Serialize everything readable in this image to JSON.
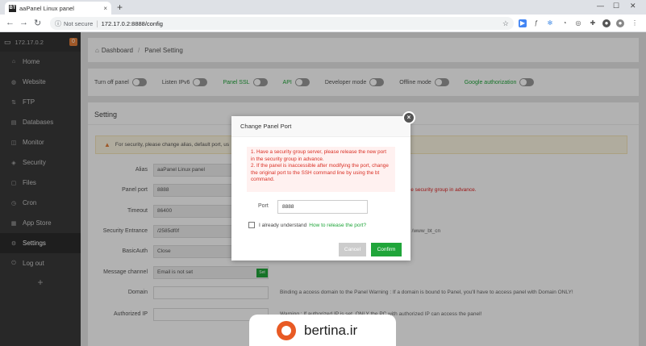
{
  "browser": {
    "tab_favicon": "BT",
    "tab_title": "aaPanel Linux panel",
    "tab_close": "×",
    "new_tab": "+",
    "win_controls": [
      "—",
      "☐",
      "✕"
    ],
    "nav_icons": [
      "←",
      "→",
      "↻"
    ],
    "not_secure": "Not secure",
    "url": "172.17.0.2:8888/config",
    "extensions": [
      "star-icon",
      "ext-icon-1",
      "ext-icon-2",
      "ext-icon-3",
      "puzzle-icon",
      "profile-icon",
      "menu-icon"
    ]
  },
  "sidebar": {
    "ip": "172.17.0.2",
    "badge": "0",
    "items": [
      {
        "label": "Home",
        "icon": "home-icon",
        "active": false
      },
      {
        "label": "Website",
        "icon": "globe-icon",
        "active": false
      },
      {
        "label": "FTP",
        "icon": "ftp-icon",
        "active": false
      },
      {
        "label": "Databases",
        "icon": "database-icon",
        "active": false
      },
      {
        "label": "Monitor",
        "icon": "monitor-icon",
        "active": false
      },
      {
        "label": "Security",
        "icon": "shield-icon",
        "active": false
      },
      {
        "label": "Files",
        "icon": "folder-icon",
        "active": false
      },
      {
        "label": "Cron",
        "icon": "clock-icon",
        "active": false
      },
      {
        "label": "App Store",
        "icon": "store-icon",
        "active": false
      },
      {
        "label": "Settings",
        "icon": "settings-icon",
        "active": true
      },
      {
        "label": "Log out",
        "icon": "logout-icon",
        "active": false
      }
    ],
    "plus": "+"
  },
  "breadcrumb": {
    "home": "Dashboard",
    "current": "Panel Setting"
  },
  "toggles": [
    {
      "label": "Turn off panel",
      "green": false
    },
    {
      "label": "Listen IPv6",
      "green": false
    },
    {
      "label": "Panel SSL",
      "green": true
    },
    {
      "label": "API",
      "green": true
    },
    {
      "label": "Developer mode",
      "green": false
    },
    {
      "label": "Offline mode",
      "green": false
    },
    {
      "label": "Google authorization",
      "green": true
    }
  ],
  "settings": {
    "heading": "Setting",
    "warning": "For security, please change alias, default port, us",
    "rows": [
      {
        "label": "Alias",
        "value": "aaPanel Linux panel",
        "note": "",
        "red": false,
        "btn": ""
      },
      {
        "label": "Panel port",
        "value": "8888",
        "note": "rs with security groups, please release the new port in the security group in advance.",
        "red": true,
        "btn": ""
      },
      {
        "label": "Timeout",
        "value": "86400",
        "note": "seconds, the panel will automatically exit",
        "red": false,
        "btn": ""
      },
      {
        "label": "Security Entrance",
        "value": "/2585df0f",
        "note": "e the panel through the specified Security Entrance, e.g. /www_bt_cn",
        "red": false,
        "btn": ""
      },
      {
        "label": "BasicAuth",
        "value": "Close",
        "note": "",
        "red": false,
        "btn": "Set"
      },
      {
        "label": "Message channel",
        "value": "Email is not set",
        "note": "",
        "red": false,
        "btn": "Set"
      },
      {
        "label": "Domain",
        "value": "",
        "note": "Binding a access domain to the Panel Warning : If a domain is bound to Panel, you'll have to access panel with Domain ONLY!",
        "red": false,
        "btn": ""
      },
      {
        "label": "Authorized IP",
        "value": "",
        "note": "Warning : If authorized IP is set, ONLY the PC with authorized IP can access the panel!",
        "red": false,
        "btn": ""
      }
    ],
    "timeout_red": "86400"
  },
  "dialog": {
    "title": "Change Panel Port",
    "close": "×",
    "warning": "1. Have a security group server, please release the new port in the security group in advance.\n2. If the panel is inaccessible after modifying the port, change the original port to the SSH command line by using the bt command.",
    "port_label": "Port",
    "port_value": "8888",
    "checkbox_label": "I already understand",
    "link": "How to release the port?",
    "cancel": "Cancel",
    "confirm": "Confirm"
  },
  "watermark": {
    "text": "bertina.ir"
  },
  "colors": {
    "green": "#20a53a",
    "sidebar": "#3a3a3a",
    "warning_red": "#d93025"
  }
}
